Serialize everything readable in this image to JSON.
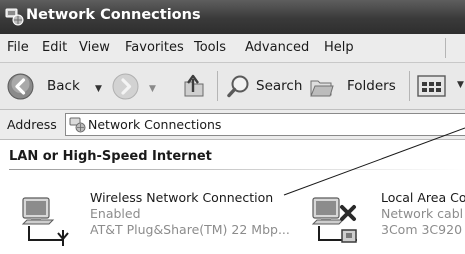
{
  "window": {
    "title": "Network Connections"
  },
  "menu": [
    "File",
    "Edit",
    "View",
    "Favorites",
    "Tools",
    "Advanced",
    "Help"
  ],
  "toolbar": {
    "back_label": "Back",
    "search_label": "Search",
    "folders_label": "Folders"
  },
  "address": {
    "label": "Address",
    "value": "Network Connections"
  },
  "section": {
    "title": "LAN or High-Speed Internet"
  },
  "connections": [
    {
      "name": "Wireless Network Connection",
      "status": "Enabled",
      "device": "AT&T Plug&Share(TM) 22 Mbp..."
    },
    {
      "name": "Local Area Co",
      "status": "Network cabl",
      "device": "3Com 3C920"
    }
  ]
}
